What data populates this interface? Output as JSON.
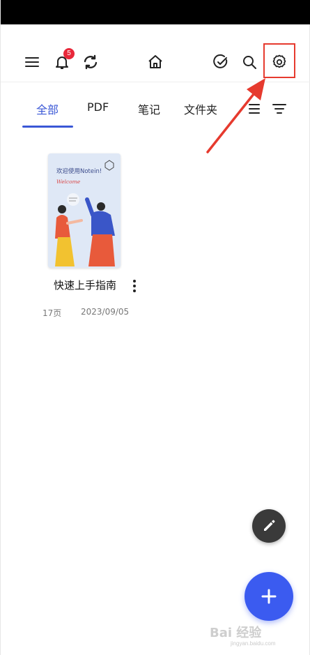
{
  "toolbar": {
    "notification_count": "5",
    "icons": [
      "menu-icon",
      "bell-icon",
      "sync-icon",
      "home-icon",
      "check-circle-icon",
      "search-icon",
      "gear-icon"
    ]
  },
  "tabs": [
    {
      "label": "全部",
      "active": true
    },
    {
      "label": "PDF",
      "active": false
    },
    {
      "label": "笔记",
      "active": false
    },
    {
      "label": "文件夹",
      "active": false
    }
  ],
  "documents": [
    {
      "title": "快速上手指南",
      "pages": "17页",
      "date": "2023/09/05",
      "thumbnail_text": "欢迎使用Notein!",
      "thumbnail_subtext": "Welcome"
    }
  ],
  "watermark": {
    "text": "Bai 经验",
    "subtext": "jingyan.baidu.com"
  },
  "colors": {
    "accent": "#3a57d6",
    "fab_add": "#3b5bf0",
    "fab_edit": "#3a3a3a",
    "badge": "#e8283a",
    "annotation": "#e63a2e"
  }
}
